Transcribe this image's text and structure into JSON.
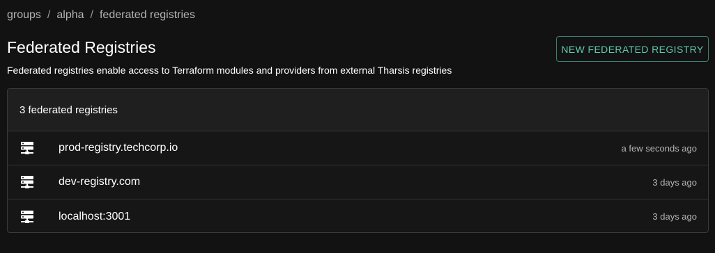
{
  "breadcrumb": {
    "items": [
      "groups",
      "alpha",
      "federated registries"
    ],
    "separator": "/"
  },
  "header": {
    "title": "Federated Registries",
    "description": "Federated registries enable access to Terraform modules and providers from external Tharsis registries",
    "new_button_label": "NEW FEDERATED REGISTRY"
  },
  "list": {
    "count_label": "3 federated registries",
    "items": [
      {
        "name": "prod-registry.techcorp.io",
        "updated": "a few seconds ago",
        "icon": "server-icon"
      },
      {
        "name": "dev-registry.com",
        "updated": "3 days ago",
        "icon": "server-icon"
      },
      {
        "name": "localhost:3001",
        "updated": "3 days ago",
        "icon": "server-icon"
      }
    ]
  },
  "colors": {
    "background": "#121212",
    "accent": "#5fc8ad",
    "border": "#3a3a3a",
    "muted_text": "#b3b3b3"
  }
}
